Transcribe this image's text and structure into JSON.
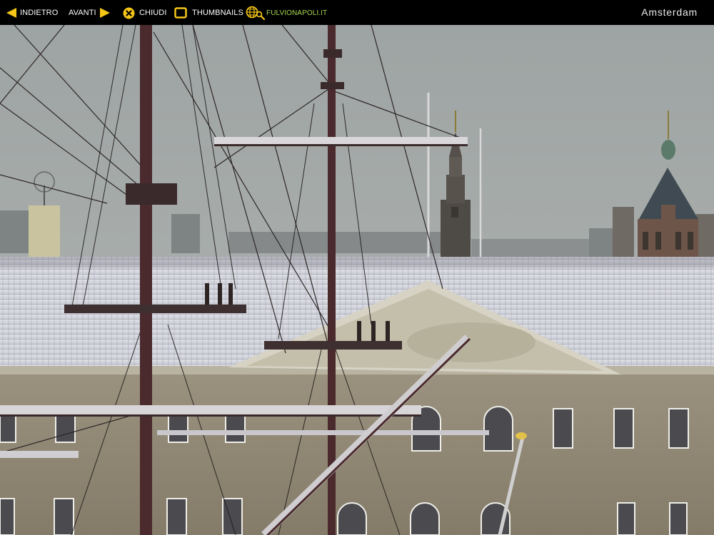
{
  "toolbar": {
    "prev_label": "INDIETRO",
    "next_label": "AVANTI",
    "close_label": "CHIUDI",
    "thumbnails_label": "THUMBNAILS",
    "site_label": "FULVIONAPOLI.IT",
    "city_title": "Amsterdam"
  },
  "icons": {
    "prev": "arrow-left-icon",
    "next": "arrow-right-icon",
    "close": "close-circle-icon",
    "thumbnails": "thumbnails-square-icon",
    "site": "globe-search-icon"
  },
  "colors": {
    "accent": "#f5c518",
    "site_link": "#a6d64e",
    "bar_background": "#000000"
  }
}
